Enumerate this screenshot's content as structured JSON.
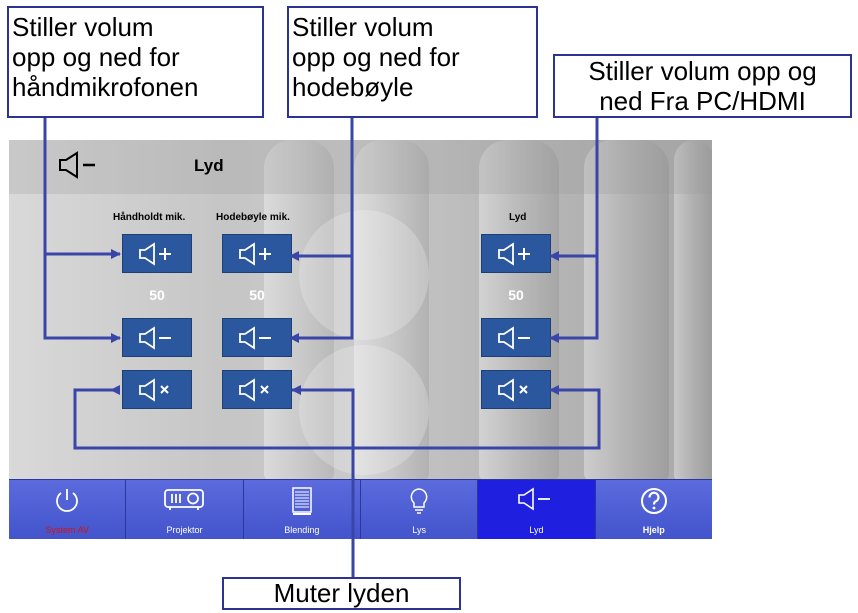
{
  "app": {
    "title": "Lyd"
  },
  "columns": [
    {
      "label": "Håndholdt mik.",
      "value": "50"
    },
    {
      "label": "Hodebøyle mik.",
      "value": "50"
    },
    {
      "label": "Lyd",
      "value": "50"
    }
  ],
  "buttons": {
    "up_icon": "volume-up-icon",
    "down_icon": "volume-down-icon",
    "mute_icon": "mute-icon"
  },
  "nav": [
    {
      "label": "System AV",
      "icon": "power-icon"
    },
    {
      "label": "Projektor",
      "icon": "projector-icon"
    },
    {
      "label": "Blending",
      "icon": "screen-icon"
    },
    {
      "label": "Lys",
      "icon": "bulb-icon"
    },
    {
      "label": "Lyd",
      "icon": "speaker-icon"
    },
    {
      "label": "Hjelp",
      "icon": "help-icon"
    }
  ],
  "callouts": {
    "handmic": [
      "Stiller volum",
      "opp og ned for",
      "håndmikrofonen"
    ],
    "headset": [
      "Stiller volum",
      "opp og ned for",
      "hodebøyle"
    ],
    "pc": [
      "Stiller volum opp og",
      "ned Fra PC/HDMI"
    ],
    "mute": "Muter lyden"
  },
  "colors": {
    "button": "#2a579d",
    "nav": "#4a5ad0",
    "nav_active": "#1f1fe0",
    "arrow": "#3a45a8",
    "system_label": "#d41111"
  }
}
